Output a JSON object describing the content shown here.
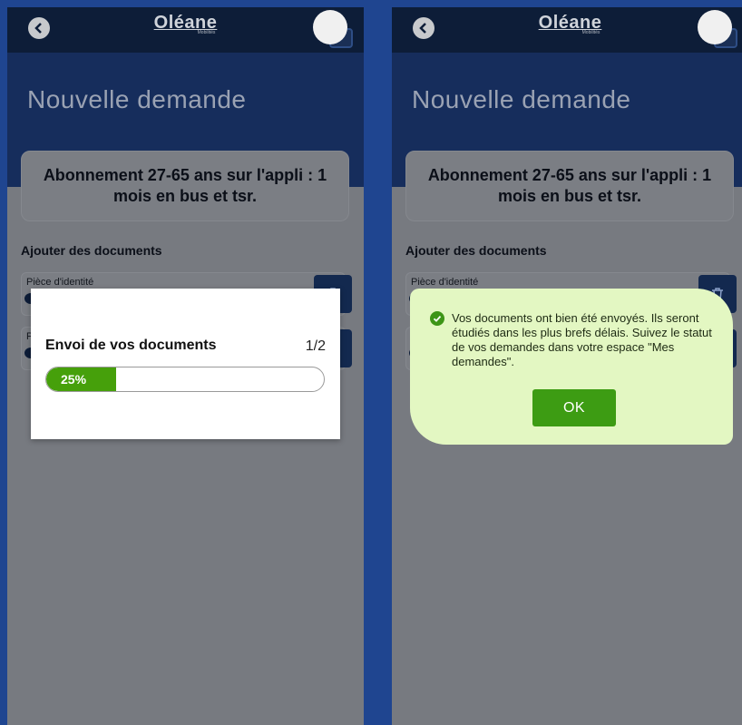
{
  "app": {
    "brand": "Oléane",
    "brand_sub": "Mobilités"
  },
  "page": {
    "title": "Nouvelle demande"
  },
  "subscription": {
    "title": "Abonnement 27-65 ans sur l'appli : 1 mois en bus et tsr."
  },
  "documents": {
    "section_title": "Ajouter des documents",
    "items": [
      {
        "label": "Pièce d'identité"
      },
      {
        "label": "P"
      }
    ]
  },
  "upload_modal": {
    "title": "Envoi de vos documents",
    "count": "1/2",
    "progress_label": "25%",
    "progress_fraction": 0.25
  },
  "success_toast": {
    "message": "Vos documents ont bien été envoyés. Ils seront étudiés dans les plus brefs délais. Suivez le statut de vos demandes dans votre espace \"Mes demandes\".",
    "ok_label": "OK"
  },
  "icons": {
    "back": "chevron-left-icon",
    "trash": "trash-icon",
    "eye": "eye-icon",
    "check": "check-circle-icon"
  },
  "colors": {
    "accent_green": "#46a00b",
    "navy": "#0d1d38",
    "toast_bg": "#e3f7c2"
  }
}
